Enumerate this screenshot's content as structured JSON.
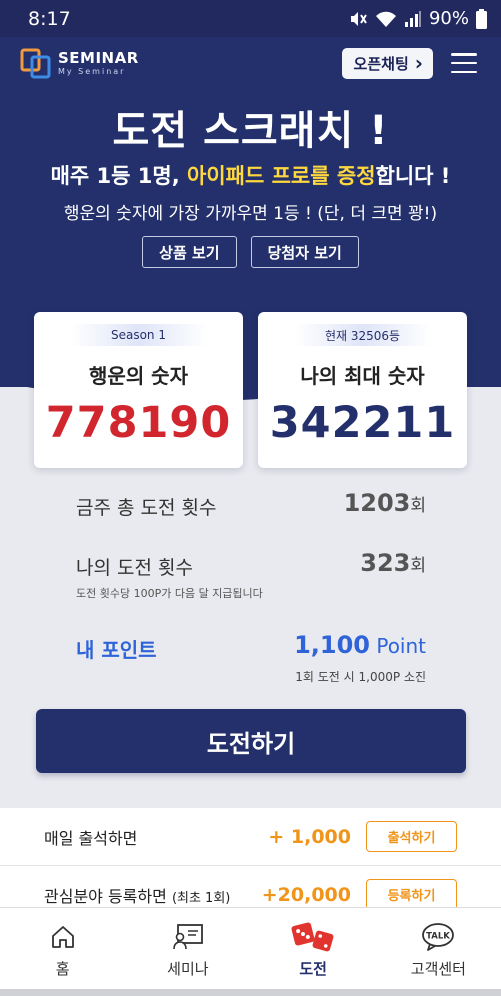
{
  "status_bar": {
    "time": "8:17",
    "battery": "90%"
  },
  "header": {
    "logo_title": "SEMINAR",
    "logo_subtitle": "My Seminar",
    "chat_button": "오픈채팅",
    "chat_chevron": "›"
  },
  "hero": {
    "title": "도전 스크래치 !",
    "sub1_pre": "매주 1등 1명, ",
    "sub1_highlight": "아이패드 프로를 증정",
    "sub1_post": "합니다 !",
    "sub2": "행운의 숫자에 가장 가까우면 1등 ! (단, 더 크면 꽝!)",
    "btn_prize": "상품 보기",
    "btn_winners": "당첨자 보기"
  },
  "cards": {
    "lucky": {
      "tag": "Season 1",
      "label": "행운의 숫자",
      "value": "778190"
    },
    "mine": {
      "tag": "현재 32506등",
      "label": "나의 최대 숫자",
      "value": "342211"
    }
  },
  "stats": {
    "total_label": "금주 총 도전 횟수",
    "total_value": "1203",
    "total_unit": "회",
    "my_label": "나의 도전 횟수",
    "my_value": "323",
    "my_unit": "회",
    "my_note": "도전 횟수당 100P가 다음 달 지급됩니다",
    "point_label": "내 포인트",
    "point_value": "1,100",
    "point_unit": " Point",
    "point_note": "1회 도전 시 1,000P 소진"
  },
  "challenge_button": "도전하기",
  "rewards": [
    {
      "label": "매일 출석하면",
      "label_small": "",
      "amount": "+ 1,000",
      "button": "출석하기"
    },
    {
      "label": "관심분야 등록하면 ",
      "label_small": "(최초 1회)",
      "amount": "+20,000",
      "button": "등록하기"
    }
  ],
  "nav": {
    "home": "홈",
    "seminar": "세미나",
    "challenge": "도전",
    "support": "고객센터",
    "talk_badge": "TALK"
  },
  "colors": {
    "navy": "#23306c",
    "lucky_red": "#d2262e",
    "highlight_yellow": "#ffd83f",
    "point_blue": "#2f63d8",
    "reward_orange": "#f0941a"
  }
}
